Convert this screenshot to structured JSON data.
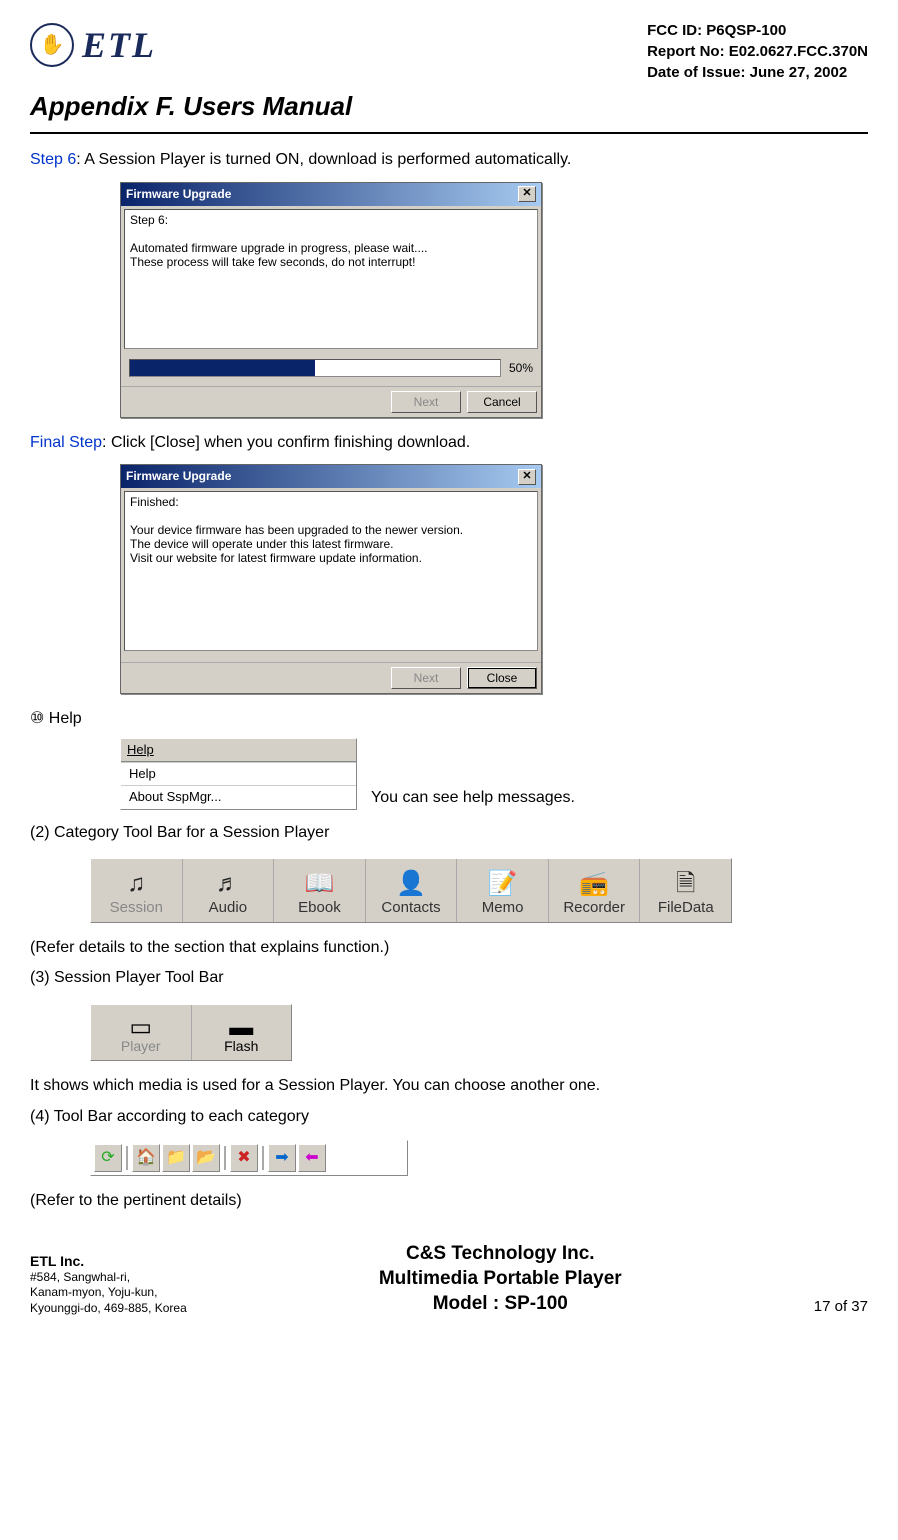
{
  "header": {
    "logo_text": "ETL",
    "fcc_id": "FCC ID: P6QSP-100",
    "report_no": "Report No: E02.0627.FCC.370N",
    "date": "Date of Issue: June 27, 2002",
    "appendix_title": "Appendix F.  Users Manual"
  },
  "step6": {
    "label": "Step 6",
    "text": ": A Session Player is turned ON, download is performed automatically.",
    "dialog_title": "Firmware Upgrade",
    "dialog_body": "Step 6:\n\nAutomated firmware upgrade in progress, please wait....\nThese process will take few seconds, do not interrupt!",
    "progress_pct": "50%",
    "next_btn": "Next",
    "cancel_btn": "Cancel"
  },
  "final_step": {
    "label": "Final Step",
    "text": ": Click [Close] when you confirm finishing download.",
    "dialog_title": "Firmware Upgrade",
    "dialog_body": "Finished:\n\nYour device firmware has been upgraded to the newer version.\nThe device will operate under this latest firmware.\nVisit our website for latest firmware update information.",
    "next_btn": "Next",
    "close_btn": "Close"
  },
  "help": {
    "bullet": "⑩  Help",
    "menu_label": "Help",
    "item1": "Help",
    "item2": "About SspMgr...",
    "caption": "You can see help messages."
  },
  "section2": {
    "title": "(2) Category Tool Bar for a Session Player",
    "items": [
      "Session",
      "Audio",
      "Ebook",
      "Contacts",
      "Memo",
      "Recorder",
      "FileData"
    ],
    "note": "(Refer details to the section that explains function.)"
  },
  "section3": {
    "title": "(3) Session Player Tool Bar",
    "items": [
      "Player",
      "Flash"
    ],
    "note": "It shows which media is used for a Session Player. You can choose another one."
  },
  "section4": {
    "title": "(4) Tool Bar according to each category",
    "note": "(Refer to the pertinent details)"
  },
  "footer": {
    "etl": "ETL Inc.",
    "addr1": "#584, Sangwhal-ri,",
    "addr2": "Kanam-myon, Yoju-kun,",
    "addr3": "Kyounggi-do, 469-885, Korea",
    "company": "C&S Technology Inc.",
    "product": "Multimedia Portable Player",
    "model": "Model : SP-100",
    "page": "17 of 37"
  }
}
